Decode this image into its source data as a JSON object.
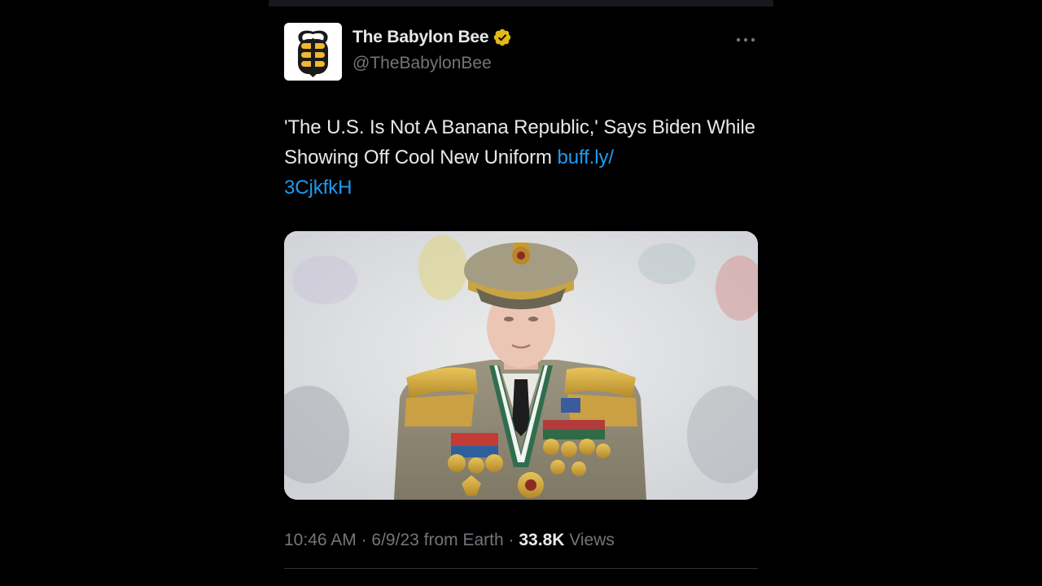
{
  "tweet": {
    "author": {
      "name": "The Babylon Bee",
      "handle": "@TheBabylonBee",
      "verified": true,
      "verified_badge_color": "#e2b719",
      "avatar_icon": "bee-logo-icon"
    },
    "more_icon": "more-options-icon",
    "text": "'The U.S. Is Not A Banana Republic,' Says Biden While Showing Off Cool New Uniform",
    "link_part1": "buff.ly/",
    "link_part2": "3CjkfkH",
    "link_color": "#1d9bf0",
    "media": {
      "icon": "photo-military-uniform-portrait"
    },
    "meta": {
      "time": "10:46 AM",
      "separator": "·",
      "date": "6/9/23",
      "source": "from Earth",
      "views_count": "33.8K",
      "views_label": "Views"
    }
  },
  "colors": {
    "background": "#000000",
    "primary_text": "#e7e9ea",
    "secondary_text": "#71767b",
    "divider": "#2f3336"
  }
}
